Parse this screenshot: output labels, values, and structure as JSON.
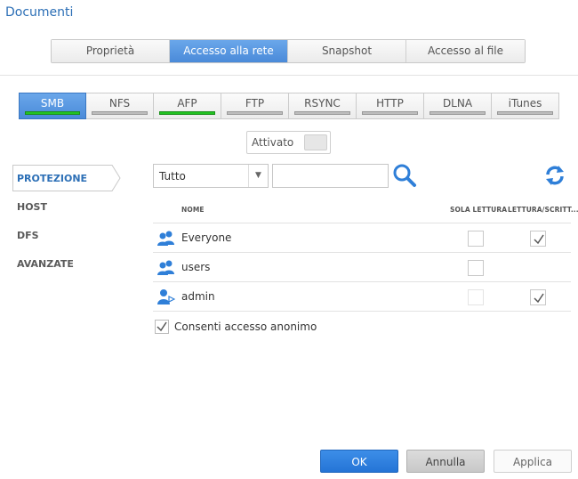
{
  "window": {
    "title": "Documenti"
  },
  "top_tabs": [
    {
      "label": "Proprietà",
      "active": false
    },
    {
      "label": "Accesso alla rete",
      "active": true
    },
    {
      "label": "Snapshot",
      "active": false
    },
    {
      "label": "Accesso al file",
      "active": false
    }
  ],
  "protocol_tabs": [
    {
      "label": "SMB",
      "active": true,
      "enabled": true
    },
    {
      "label": "NFS",
      "active": false,
      "enabled": false
    },
    {
      "label": "AFP",
      "active": false,
      "enabled": true
    },
    {
      "label": "FTP",
      "active": false,
      "enabled": false
    },
    {
      "label": "RSYNC",
      "active": false,
      "enabled": false
    },
    {
      "label": "HTTP",
      "active": false,
      "enabled": false
    },
    {
      "label": "DLNA",
      "active": false,
      "enabled": false
    },
    {
      "label": "iTunes",
      "active": false,
      "enabled": false
    }
  ],
  "toggle": {
    "label": "Attivato",
    "on": false
  },
  "side_nav": [
    {
      "label": "PROTEZIONE",
      "active": true
    },
    {
      "label": "HOST",
      "active": false
    },
    {
      "label": "DFS",
      "active": false
    },
    {
      "label": "AVANZATE",
      "active": false
    }
  ],
  "filter": {
    "selected": "Tutto",
    "search_value": ""
  },
  "table": {
    "headers": {
      "name": "NOME",
      "read_only": "SOLA LETTURA",
      "read_write": "LETTURA/SCRITT..."
    },
    "rows": [
      {
        "name": "Everyone",
        "icon": "group-icon",
        "read_only": false,
        "read_write": true,
        "read_only_enabled": true,
        "read_write_enabled": true
      },
      {
        "name": "users",
        "icon": "group-icon",
        "read_only": false,
        "read_write": false,
        "read_only_enabled": true,
        "read_write_enabled": false
      },
      {
        "name": "admin",
        "icon": "admin-user-icon",
        "read_only": false,
        "read_write": true,
        "read_only_enabled": false,
        "read_write_enabled": true
      }
    ]
  },
  "anonymous": {
    "label": "Consenti accesso anonimo",
    "checked": true
  },
  "buttons": {
    "ok": "OK",
    "cancel": "Annulla",
    "apply": "Applica"
  },
  "colors": {
    "accent": "#2c6fb6",
    "active_tab": "#4a8ad9",
    "enabled_bar": "#22c322"
  }
}
